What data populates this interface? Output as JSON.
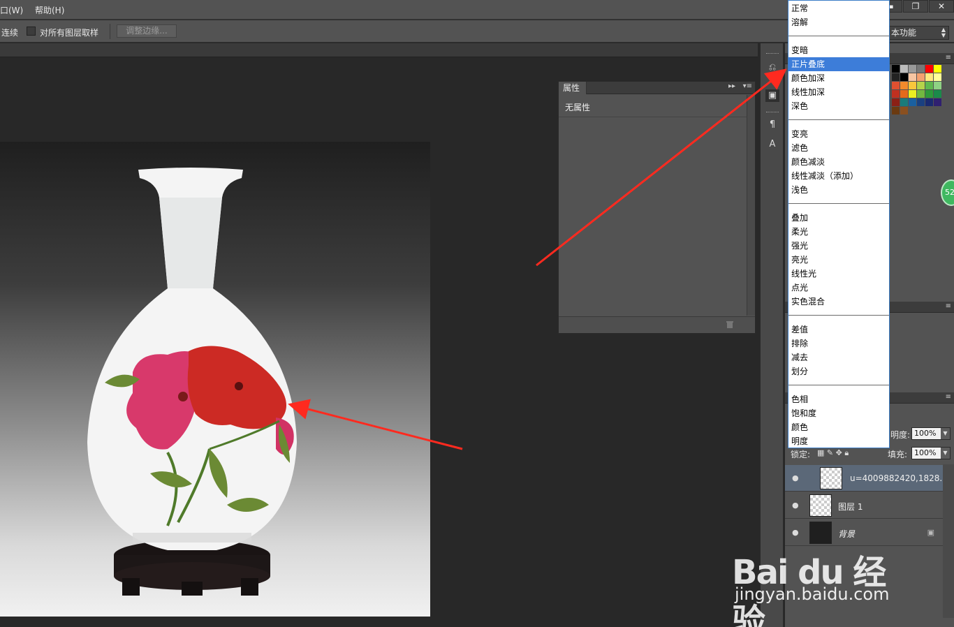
{
  "menubar": {
    "window_menu": "口(W)",
    "help_menu": "帮助(H)"
  },
  "window_controls": {
    "minimize": "▬",
    "restore": "❐",
    "close": "✕"
  },
  "options_bar": {
    "contiguous_label": "连续",
    "sample_all_layers_label": "对所有图层取样",
    "refine_edge_label": "调整边缘...",
    "workspace_value": "本功能"
  },
  "properties_panel": {
    "tab_label": "属性",
    "empty_label": "无属性"
  },
  "blend_modes": {
    "selected": "正片叠底",
    "groups": [
      [
        "正常",
        "溶解"
      ],
      [
        "变暗",
        "正片叠底",
        "颜色加深",
        "线性加深",
        "深色"
      ],
      [
        "变亮",
        "滤色",
        "颜色减淡",
        "线性减淡（添加）",
        "浅色"
      ],
      [
        "叠加",
        "柔光",
        "强光",
        "亮光",
        "线性光",
        "点光",
        "实色混合"
      ],
      [
        "差值",
        "排除",
        "减去",
        "划分"
      ],
      [
        "色相",
        "饱和度",
        "颜色",
        "明度"
      ]
    ]
  },
  "layers_panel": {
    "opacity_label": "明度:",
    "opacity_value": "100%",
    "lock_label": "锁定:",
    "fill_label": "填充:",
    "fill_value": "100%",
    "layers": [
      {
        "name": "u=4009882420,1828...",
        "selected": true
      },
      {
        "name": "图层 1",
        "selected": false
      },
      {
        "name": "背景",
        "selected": false
      }
    ]
  },
  "badge": "52",
  "watermark": {
    "main": "Bai du 经验",
    "url": "jingyan.baidu.com"
  },
  "colors": {
    "accent_selected": "#3d7dd9",
    "annotation_arrow": "#ff2a1f",
    "panel_bg": "#535353"
  },
  "icons": [
    "eye-icon",
    "lock-icon",
    "trash-icon",
    "panel-menu-icon",
    "history-icon",
    "paragraph-icon",
    "character-icon"
  ]
}
